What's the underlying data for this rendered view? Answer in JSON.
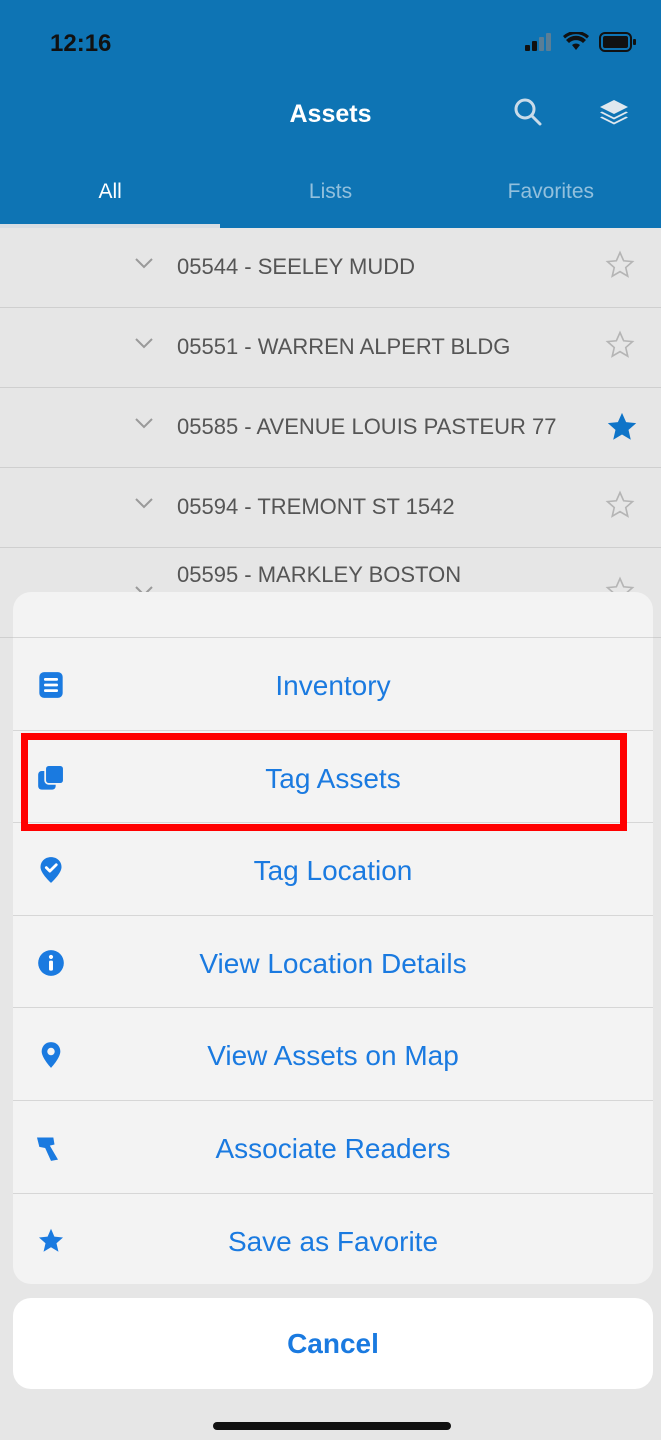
{
  "status": {
    "time": "12:16"
  },
  "header": {
    "title": "Assets"
  },
  "tabs": [
    {
      "label": "All"
    },
    {
      "label": "Lists"
    },
    {
      "label": "Favorites"
    }
  ],
  "rows": [
    {
      "label": "05544  -  SEELEY MUDD",
      "favorite": false
    },
    {
      "label": "05551  -  WARREN ALPERT BLDG",
      "favorite": false
    },
    {
      "label": "05585  -  AVENUE LOUIS PASTEUR 77",
      "favorite": true
    },
    {
      "label": "05594  - TREMONT ST 1542",
      "favorite": false
    },
    {
      "label": "05595  -  MARKLEY BOSTON",
      "favorite": false
    }
  ],
  "actions": [
    {
      "label": "Inventory",
      "icon": "list-icon"
    },
    {
      "label": "Tag Assets",
      "icon": "copy-icon"
    },
    {
      "label": "Tag Location",
      "icon": "location-check-icon"
    },
    {
      "label": "View Location Details",
      "icon": "info-icon"
    },
    {
      "label": "View Assets on Map",
      "icon": "map-pin-icon"
    },
    {
      "label": "Associate Readers",
      "icon": "reader-icon"
    },
    {
      "label": "Save as Favorite",
      "icon": "star-icon"
    }
  ],
  "cancel_label": "Cancel",
  "colors": {
    "header": "#0e74b4",
    "accent": "#1a7ae0",
    "highlight": "#ff0000"
  }
}
